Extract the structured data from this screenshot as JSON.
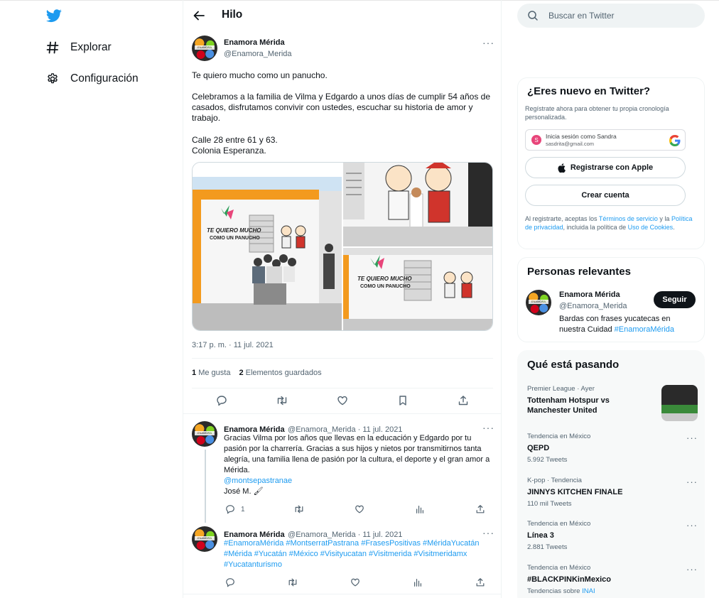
{
  "nav": {
    "logo": "twitter-bird-icon",
    "items": [
      {
        "icon": "hashtag-icon",
        "label": "Explorar"
      },
      {
        "icon": "gear-icon",
        "label": "Configuración"
      }
    ]
  },
  "header": {
    "title": "Hilo"
  },
  "main_tweet": {
    "name": "Enamora Mérida",
    "handle": "@Enamora_Merida",
    "avatar_text": "ENAMORA MÉRIDA",
    "text_line1": "Te quiero mucho como un panucho.",
    "text_para2": "Celebramos a la familia de Vilma y Edgardo a unos días de cumplir 54 años de casados, disfrutamos convivir con ustedes, escuchar su historia de amor y trabajo.",
    "text_para3": "Calle 28 entre 61 y 63.\nColonia Esperanza.",
    "mural_text": "TE QUIERO MUCHO COMO UN PANUCHO",
    "meta": "3:17 p. m. · 11 jul. 2021",
    "likes_count": "1",
    "likes_label": "Me gusta",
    "bookmarks_count": "2",
    "bookmarks_label": "Elementos guardados"
  },
  "replies": [
    {
      "name": "Enamora Mérida",
      "handle": "@Enamora_Merida · 11 jul. 2021",
      "text": "Gracias Vilma por los años que llevas en la educación y Edgardo por tu pasión por la charrería. Gracias a sus hijos y nietos por transmitirnos tanta alegría, una familia llena de pasión por la cultura, el deporte y el gran amor a Mérida.",
      "mention": "@montsepastranae",
      "signature": "José M. 🖌",
      "reply_count": "1"
    },
    {
      "name": "Enamora Mérida",
      "handle": "@Enamora_Merida · 11 jul. 2021",
      "hashtags": "#EnamoraMérida #MontserratPastrana #FrasesPositivas #MéridaYucatán #Mérida #Yucatán #México #Visityucatan #Visitmerida #Visitmeridamx #Yucatanturismo"
    }
  ],
  "search": {
    "placeholder": "Buscar en Twitter"
  },
  "signup": {
    "title": "¿Eres nuevo en Twitter?",
    "subtitle": "Regístrate ahora para obtener tu propia cronología personalizada.",
    "google_line1": "Inicia sesión como Sandra",
    "google_line2": "sasdrita@gmail.com",
    "google_initial": "S",
    "apple_label": "Registrarse con Apple",
    "create_label": "Crear cuenta",
    "legal_prefix": "Al registrarte, aceptas los ",
    "legal_terms": "Términos de servicio",
    "legal_and": " y la ",
    "legal_privacy": "Política de privacidad",
    "legal_mid": ", incluida la política de ",
    "legal_cookies": "Uso de Cookies",
    "legal_end": "."
  },
  "relevant": {
    "title": "Personas relevantes",
    "name": "Enamora Mérida",
    "handle": "@Enamora_Merida",
    "follow_label": "Seguir",
    "bio_text": "Bardas con frases yucatecas en nuestra Cuidad ",
    "bio_tag": "#EnamoraMérida"
  },
  "trends": {
    "title": "Qué está pasando",
    "items": [
      {
        "context": "Premier League · Ayer",
        "title": "Tottenham Hotspur vs Manchester United",
        "count": ""
      },
      {
        "context": "Tendencia en México",
        "title": "QEPD",
        "count": "5.992 Tweets"
      },
      {
        "context": "K-pop · Tendencia",
        "title": "JINNYS KITCHEN FINALE",
        "count": "110 mil Tweets"
      },
      {
        "context": "Tendencia en México",
        "title": "Línea 3",
        "count": "2.881 Tweets"
      },
      {
        "context": "Tendencia en México",
        "title": "#BLACKPINKinMexico",
        "count_prefix": "Tendencias sobre ",
        "count_link": "INAI"
      }
    ]
  },
  "colors": {
    "accent": "#1d9bf0",
    "text": "#0f1419",
    "muted": "#536471"
  }
}
